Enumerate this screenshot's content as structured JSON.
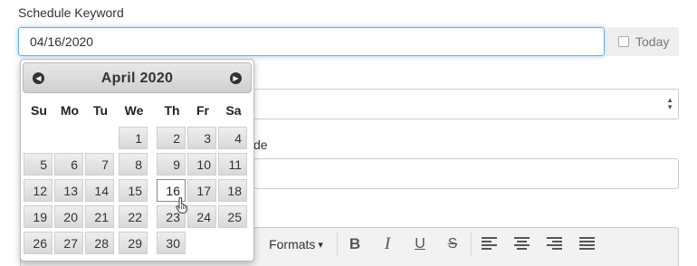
{
  "form": {
    "schedule_label": "Schedule Keyword",
    "date_value": "04/16/2020",
    "today_label": "Today",
    "partial_label": "de"
  },
  "toolbar": {
    "formats_label": "Formats",
    "formats_caret": "▾",
    "bold": "B",
    "italic": "I",
    "underline": "U",
    "strike": "S"
  },
  "datepicker": {
    "title": "April 2020",
    "prev_icon": "◀",
    "next_icon": "▶",
    "weekdays": [
      "Su",
      "Mo",
      "Tu",
      "We",
      "Th",
      "Fr",
      "Sa"
    ],
    "selected_day": "16",
    "days": [
      "1",
      "2",
      "3",
      "4",
      "5",
      "6",
      "7",
      "8",
      "9",
      "10",
      "11",
      "12",
      "13",
      "14",
      "15",
      "16",
      "17",
      "18",
      "19",
      "20",
      "21",
      "22",
      "23",
      "24",
      "25",
      "26",
      "27",
      "28",
      "29",
      "30"
    ]
  },
  "select": {
    "arrows": "▲▼"
  },
  "icons": [
    "calendar-prev-icon",
    "calendar-next-icon",
    "hand-pointer-icon",
    "align-left-icon",
    "align-center-icon",
    "align-right-icon",
    "align-justify-icon"
  ]
}
